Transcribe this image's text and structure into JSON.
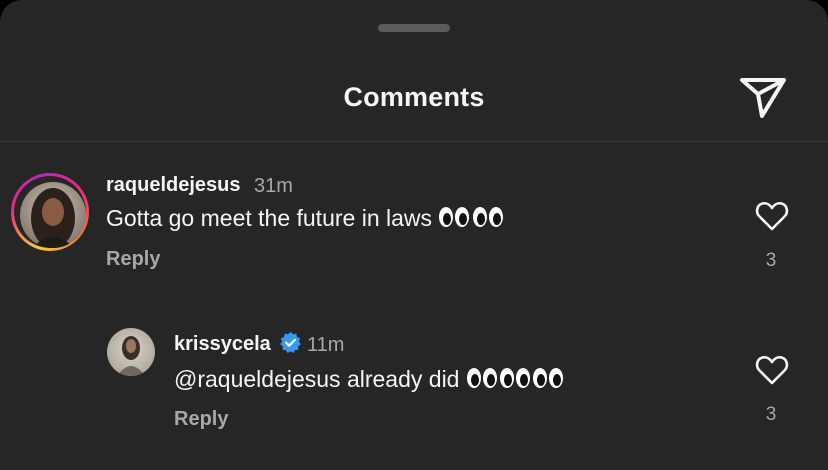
{
  "header": {
    "title": "Comments",
    "share_icon": "paper-plane-icon"
  },
  "comments": [
    {
      "username": "raqueldejesus",
      "time": "31m",
      "text": "Gotta go meet the future in laws",
      "emoji": "👀👀",
      "reply_label": "Reply",
      "likes": "3",
      "avatar_story_ring": true
    },
    {
      "username": "krissycela",
      "verified": true,
      "time": "11m",
      "text": "@raqueldejesus already did",
      "emoji": "👀👀👀",
      "reply_label": "Reply",
      "likes": "3"
    }
  ],
  "colors": {
    "background": "#262626",
    "text_primary": "#f5f5f5",
    "text_secondary": "#a8a8a8",
    "verified_blue": "#3897f0"
  }
}
